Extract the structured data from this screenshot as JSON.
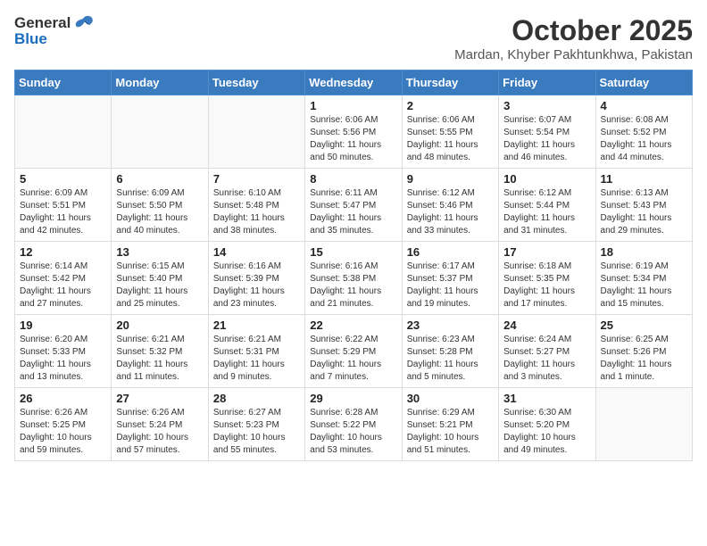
{
  "header": {
    "logo_general": "General",
    "logo_blue": "Blue",
    "month": "October 2025",
    "location": "Mardan, Khyber Pakhtunkhwa, Pakistan"
  },
  "days_of_week": [
    "Sunday",
    "Monday",
    "Tuesday",
    "Wednesday",
    "Thursday",
    "Friday",
    "Saturday"
  ],
  "weeks": [
    [
      {
        "day": "",
        "info": ""
      },
      {
        "day": "",
        "info": ""
      },
      {
        "day": "",
        "info": ""
      },
      {
        "day": "1",
        "info": "Sunrise: 6:06 AM\nSunset: 5:56 PM\nDaylight: 11 hours and 50 minutes."
      },
      {
        "day": "2",
        "info": "Sunrise: 6:06 AM\nSunset: 5:55 PM\nDaylight: 11 hours and 48 minutes."
      },
      {
        "day": "3",
        "info": "Sunrise: 6:07 AM\nSunset: 5:54 PM\nDaylight: 11 hours and 46 minutes."
      },
      {
        "day": "4",
        "info": "Sunrise: 6:08 AM\nSunset: 5:52 PM\nDaylight: 11 hours and 44 minutes."
      }
    ],
    [
      {
        "day": "5",
        "info": "Sunrise: 6:09 AM\nSunset: 5:51 PM\nDaylight: 11 hours and 42 minutes."
      },
      {
        "day": "6",
        "info": "Sunrise: 6:09 AM\nSunset: 5:50 PM\nDaylight: 11 hours and 40 minutes."
      },
      {
        "day": "7",
        "info": "Sunrise: 6:10 AM\nSunset: 5:48 PM\nDaylight: 11 hours and 38 minutes."
      },
      {
        "day": "8",
        "info": "Sunrise: 6:11 AM\nSunset: 5:47 PM\nDaylight: 11 hours and 35 minutes."
      },
      {
        "day": "9",
        "info": "Sunrise: 6:12 AM\nSunset: 5:46 PM\nDaylight: 11 hours and 33 minutes."
      },
      {
        "day": "10",
        "info": "Sunrise: 6:12 AM\nSunset: 5:44 PM\nDaylight: 11 hours and 31 minutes."
      },
      {
        "day": "11",
        "info": "Sunrise: 6:13 AM\nSunset: 5:43 PM\nDaylight: 11 hours and 29 minutes."
      }
    ],
    [
      {
        "day": "12",
        "info": "Sunrise: 6:14 AM\nSunset: 5:42 PM\nDaylight: 11 hours and 27 minutes."
      },
      {
        "day": "13",
        "info": "Sunrise: 6:15 AM\nSunset: 5:40 PM\nDaylight: 11 hours and 25 minutes."
      },
      {
        "day": "14",
        "info": "Sunrise: 6:16 AM\nSunset: 5:39 PM\nDaylight: 11 hours and 23 minutes."
      },
      {
        "day": "15",
        "info": "Sunrise: 6:16 AM\nSunset: 5:38 PM\nDaylight: 11 hours and 21 minutes."
      },
      {
        "day": "16",
        "info": "Sunrise: 6:17 AM\nSunset: 5:37 PM\nDaylight: 11 hours and 19 minutes."
      },
      {
        "day": "17",
        "info": "Sunrise: 6:18 AM\nSunset: 5:35 PM\nDaylight: 11 hours and 17 minutes."
      },
      {
        "day": "18",
        "info": "Sunrise: 6:19 AM\nSunset: 5:34 PM\nDaylight: 11 hours and 15 minutes."
      }
    ],
    [
      {
        "day": "19",
        "info": "Sunrise: 6:20 AM\nSunset: 5:33 PM\nDaylight: 11 hours and 13 minutes."
      },
      {
        "day": "20",
        "info": "Sunrise: 6:21 AM\nSunset: 5:32 PM\nDaylight: 11 hours and 11 minutes."
      },
      {
        "day": "21",
        "info": "Sunrise: 6:21 AM\nSunset: 5:31 PM\nDaylight: 11 hours and 9 minutes."
      },
      {
        "day": "22",
        "info": "Sunrise: 6:22 AM\nSunset: 5:29 PM\nDaylight: 11 hours and 7 minutes."
      },
      {
        "day": "23",
        "info": "Sunrise: 6:23 AM\nSunset: 5:28 PM\nDaylight: 11 hours and 5 minutes."
      },
      {
        "day": "24",
        "info": "Sunrise: 6:24 AM\nSunset: 5:27 PM\nDaylight: 11 hours and 3 minutes."
      },
      {
        "day": "25",
        "info": "Sunrise: 6:25 AM\nSunset: 5:26 PM\nDaylight: 11 hours and 1 minute."
      }
    ],
    [
      {
        "day": "26",
        "info": "Sunrise: 6:26 AM\nSunset: 5:25 PM\nDaylight: 10 hours and 59 minutes."
      },
      {
        "day": "27",
        "info": "Sunrise: 6:26 AM\nSunset: 5:24 PM\nDaylight: 10 hours and 57 minutes."
      },
      {
        "day": "28",
        "info": "Sunrise: 6:27 AM\nSunset: 5:23 PM\nDaylight: 10 hours and 55 minutes."
      },
      {
        "day": "29",
        "info": "Sunrise: 6:28 AM\nSunset: 5:22 PM\nDaylight: 10 hours and 53 minutes."
      },
      {
        "day": "30",
        "info": "Sunrise: 6:29 AM\nSunset: 5:21 PM\nDaylight: 10 hours and 51 minutes."
      },
      {
        "day": "31",
        "info": "Sunrise: 6:30 AM\nSunset: 5:20 PM\nDaylight: 10 hours and 49 minutes."
      },
      {
        "day": "",
        "info": ""
      }
    ]
  ]
}
